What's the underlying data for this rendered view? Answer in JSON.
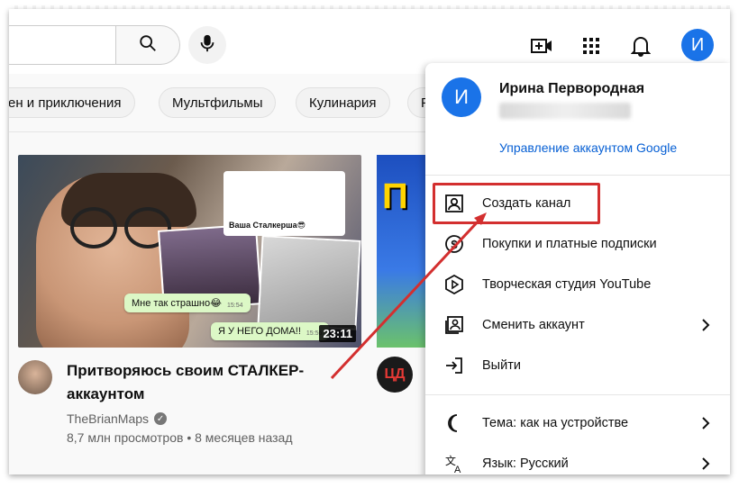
{
  "header": {
    "search_placeholder": "",
    "icons": [
      "search-icon",
      "mic-icon",
      "create-video-icon",
      "apps-icon",
      "notifications-icon"
    ],
    "avatar_letter": "И"
  },
  "chips": [
    {
      "label": "ен и приключения"
    },
    {
      "label": "Мультфильмы"
    },
    {
      "label": "Кулинария"
    },
    {
      "label": "Р"
    }
  ],
  "video": {
    "title": "Притворяюсь своим СТАЛКЕР-аккаунтом",
    "channel": "TheBrianMaps",
    "meta": "8,7 млн просмотров • 8 месяцев назад",
    "duration": "23:11",
    "thumbnail_texts": {
      "insta_caption": "Ваша Сталкерша😎",
      "bubble1": "Мне так страшно😂",
      "bubble1_time": "15:54",
      "bubble2": "Я У НЕГО ДОМА!!",
      "bubble2_time": "15:56"
    }
  },
  "video2": {
    "thumb_letter": "П",
    "channel_badge": "ЦД"
  },
  "account_menu": {
    "avatar_letter": "И",
    "name": "Ирина Первородная",
    "manage_link": "Управление аккаунтом Google",
    "items": [
      {
        "label": "Создать канал",
        "icon": "person-box-icon",
        "has_chevron": false
      },
      {
        "label": "Покупки и платные подписки",
        "icon": "dollar-circle-icon",
        "has_chevron": false
      },
      {
        "label": "Творческая студия YouTube",
        "icon": "studio-play-icon",
        "has_chevron": false
      },
      {
        "label": "Сменить аккаунт",
        "icon": "switch-account-icon",
        "has_chevron": true
      },
      {
        "label": "Выйти",
        "icon": "sign-out-icon",
        "has_chevron": false
      },
      {
        "label": "Тема: как на устройстве",
        "icon": "moon-icon",
        "has_chevron": true
      },
      {
        "label": "Язык: Русский",
        "icon": "translate-icon",
        "has_chevron": true
      }
    ]
  },
  "colors": {
    "accent_blue": "#1a73e8",
    "link_blue": "#065fd4",
    "highlight_red": "#d32f2f"
  }
}
